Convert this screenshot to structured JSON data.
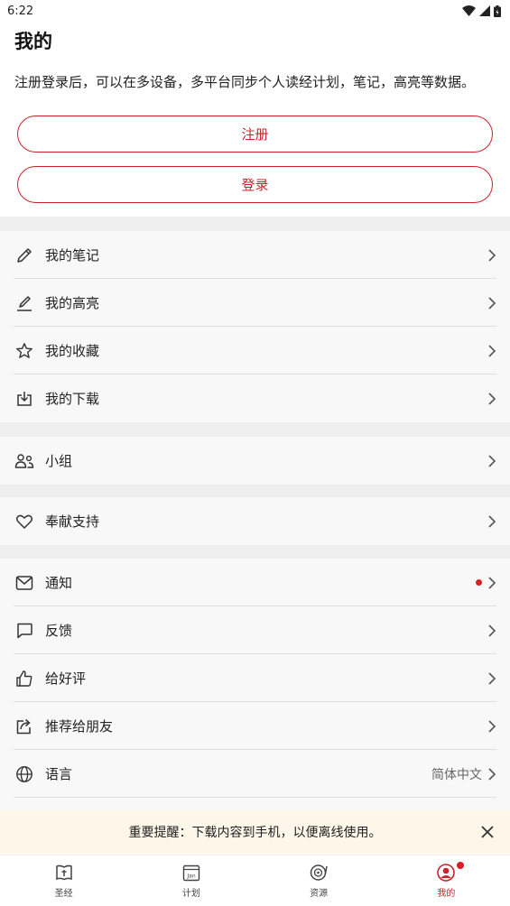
{
  "status_bar": {
    "time": "6:22"
  },
  "page": {
    "title": "我的",
    "intro": "注册登录后，可以在多设备，多平台同步个人读经计划，笔记，高亮等数据。"
  },
  "auth": {
    "register_label": "注册",
    "login_label": "登录"
  },
  "menu": {
    "notes": "我的笔记",
    "highlights": "我的高亮",
    "favorites": "我的收藏",
    "downloads": "我的下载",
    "groups": "小组",
    "donate": "奉献支持",
    "notifications": "通知",
    "feedback": "反馈",
    "rate": "给好评",
    "recommend": "推荐给朋友",
    "language": "语言",
    "language_value": "简体中文"
  },
  "banner": {
    "text": "重要提醒：下载内容到手机，以便离线使用。"
  },
  "tabbar": {
    "bible": "圣经",
    "plan": "计划",
    "plan_icon_text": "Jan",
    "resources": "资源",
    "mine": "我的"
  },
  "colors": {
    "accent": "#c8242c",
    "badge": "#d81f26",
    "banner_bg": "#fdf6e9",
    "band": "#efefef"
  }
}
